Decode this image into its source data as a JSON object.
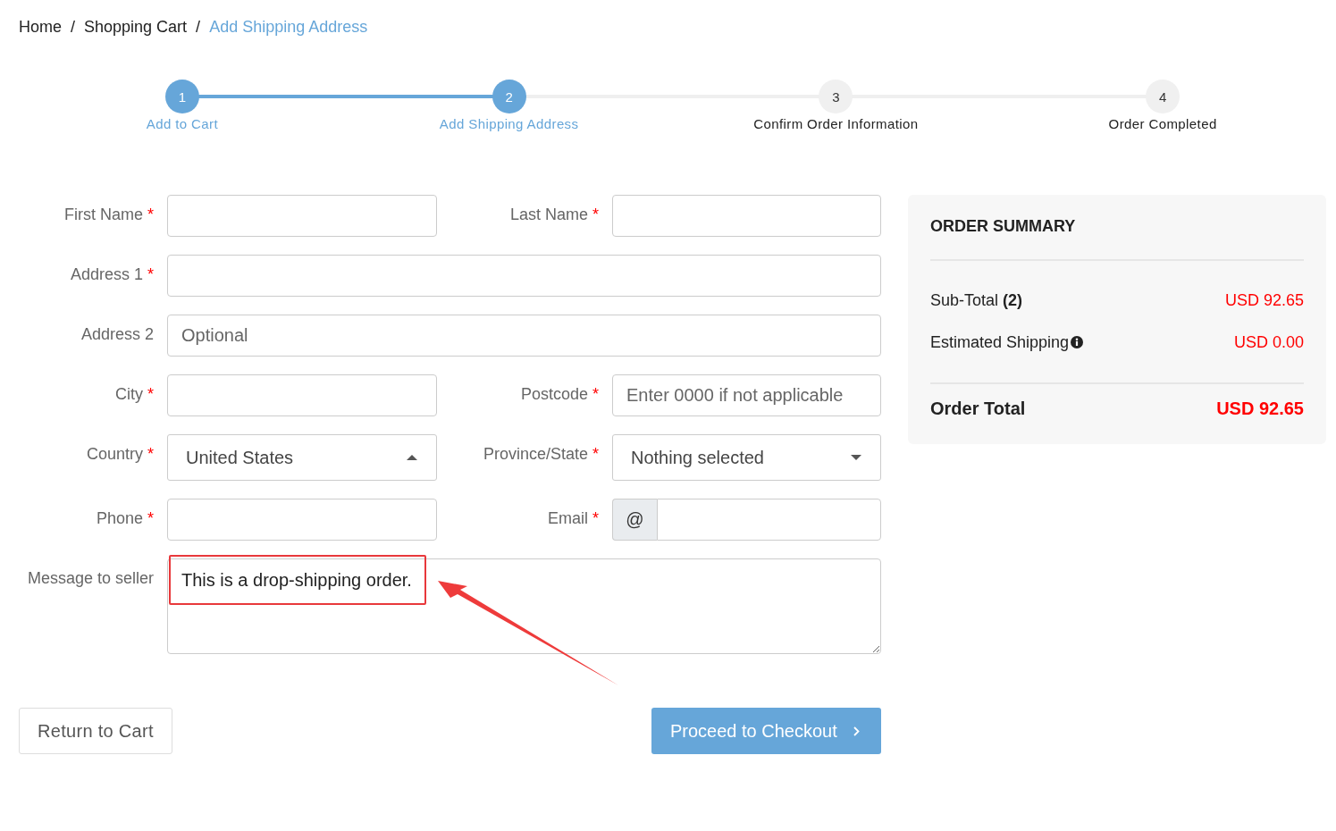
{
  "breadcrumb": {
    "items": [
      {
        "label": "Home",
        "selected": false
      },
      {
        "label": "Shopping Cart",
        "selected": false
      },
      {
        "label": "Add Shipping Address",
        "selected": true
      }
    ],
    "separators": [
      "/",
      "/"
    ]
  },
  "steps": [
    {
      "number": "1",
      "label": "Add to Cart",
      "reached": true
    },
    {
      "number": "2",
      "label": "Add Shipping Address",
      "reached": true
    },
    {
      "number": "3",
      "label": "Confirm Order Information",
      "reached": false
    },
    {
      "number": "4",
      "label": "Order Completed",
      "reached": false
    }
  ],
  "form": {
    "rows": [
      [
        {
          "kind": "text",
          "label": "First Name",
          "required_mark": "*"
        },
        {
          "kind": "text",
          "label": "Last Name",
          "required_mark": "*"
        }
      ],
      [
        {
          "kind": "text",
          "label": "Address 1",
          "required_mark": "*"
        }
      ],
      [
        {
          "kind": "text",
          "label": "Address 2",
          "placeholder": "Optional"
        }
      ],
      [
        {
          "kind": "text",
          "label": "City",
          "required_mark": "*"
        },
        {
          "kind": "text",
          "label": "Postcode",
          "required_mark": "*",
          "placeholder": "Enter 0000 if not applicable"
        }
      ],
      [
        {
          "kind": "select",
          "label": "Country",
          "required_mark": "*",
          "value": "United States",
          "expanded": true
        },
        {
          "kind": "select",
          "label": "Province/State",
          "required_mark": "*",
          "value": "Nothing selected",
          "expanded": false
        }
      ],
      [
        {
          "kind": "text",
          "label": "Phone",
          "required_mark": "*"
        },
        {
          "kind": "email",
          "label": "Email",
          "required_mark": "*",
          "addon": "@"
        }
      ],
      [
        {
          "kind": "textarea",
          "label": "Message to seller",
          "value": "This is a drop-shipping order.",
          "annotated": true
        }
      ]
    ]
  },
  "actions": [
    {
      "kind": "secondary",
      "label": "Return to Cart"
    },
    {
      "kind": "primary",
      "label": "Proceed to Checkout"
    }
  ],
  "summary": {
    "title": "ORDER SUMMARY",
    "lines": [
      {
        "label": "Sub-Total **(2)**",
        "value": "USD 92.65",
        "info": false
      },
      {
        "label": "Estimated Shipping",
        "value": "USD 0.00",
        "info": true
      }
    ],
    "total": {
      "label": "Order Total",
      "value": "USD 92.65"
    }
  }
}
